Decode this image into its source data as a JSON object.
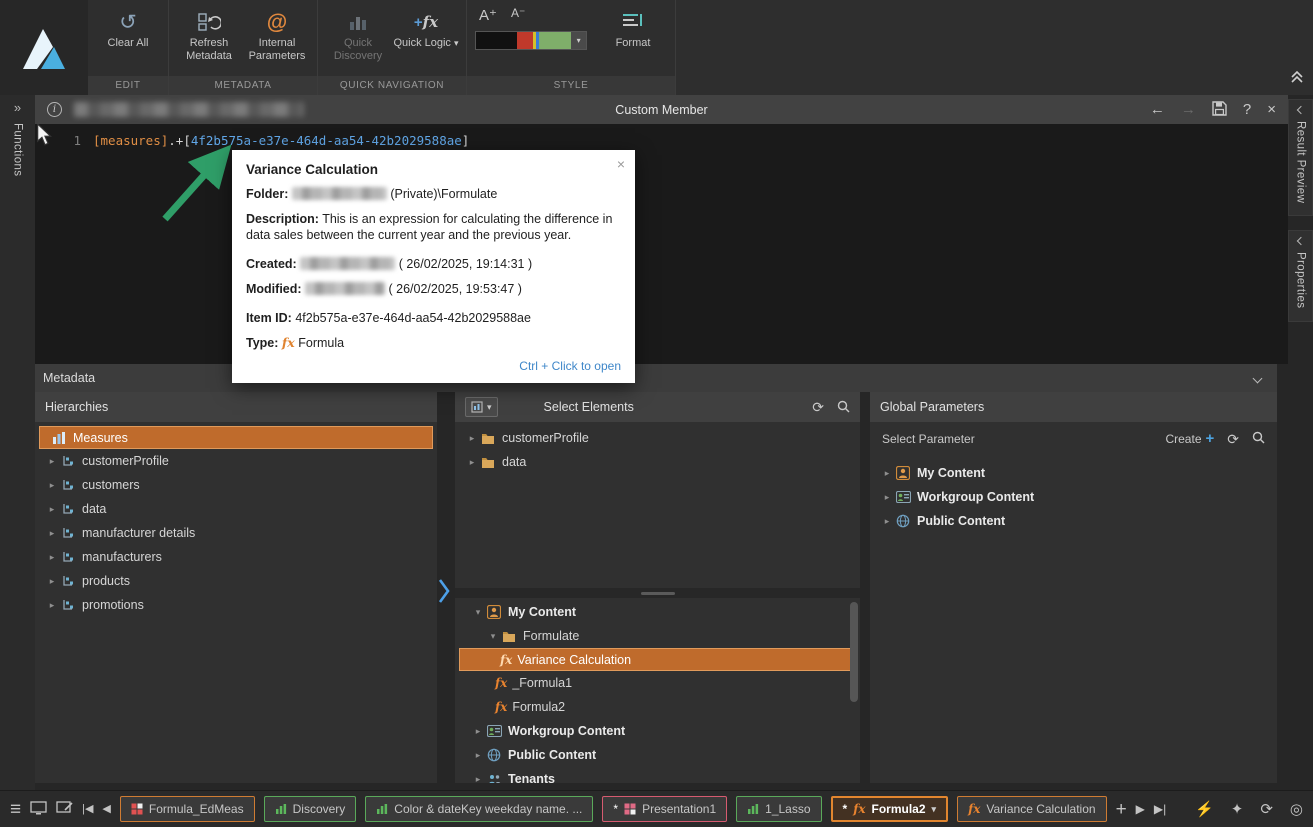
{
  "ribbon": {
    "groups": [
      {
        "label": "EDIT"
      },
      {
        "label": "METADATA"
      },
      {
        "label": "QUICK NAVIGATION"
      },
      {
        "label": "STYLE"
      }
    ],
    "buttons": {
      "clear_all": "Clear All",
      "refresh_metadata": "Refresh Metadata",
      "internal_parameters": "Internal Parameters",
      "quick_discovery": "Quick Discovery",
      "quick_logic": "Quick Logic",
      "format": "Format"
    }
  },
  "editor": {
    "title": "Custom Member",
    "line_number": "1",
    "code": {
      "measure": "[measures]",
      "operator": ".+",
      "bracket_open": "[",
      "guid": "4f2b575a-e37e-464d-aa54-42b2029588ae",
      "bracket_close": "]"
    }
  },
  "tooltip": {
    "title": "Variance Calculation",
    "folder_label": "Folder:",
    "folder_value": "(Private)\\Formulate",
    "description_label": "Description:",
    "description": "This is an expression for calculating the difference in data sales between the current year and the previous year.",
    "created_label": "Created:",
    "created_value": "( 26/02/2025, 19:14:31 )",
    "modified_label": "Modified:",
    "modified_value": "( 26/02/2025, 19:53:47 )",
    "item_id_label": "Item ID:",
    "item_id": "4f2b575a-e37e-464d-aa54-42b2029588ae",
    "type_label": "Type:",
    "type_value": "Formula",
    "open_hint": "Ctrl + Click to open"
  },
  "side_tabs": {
    "left": "Functions",
    "right": [
      {
        "label": "Result Preview"
      },
      {
        "label": "Properties"
      }
    ]
  },
  "metadata_section": {
    "title": "Metadata"
  },
  "hierarchies": {
    "title": "Hierarchies",
    "items": [
      {
        "label": "Measures",
        "selected": true
      },
      {
        "label": "customerProfile"
      },
      {
        "label": "customers"
      },
      {
        "label": "data"
      },
      {
        "label": "manufacturer details"
      },
      {
        "label": "manufacturers"
      },
      {
        "label": "products"
      },
      {
        "label": "promotions"
      }
    ]
  },
  "select_elements": {
    "title": "Select Elements",
    "folders": [
      {
        "label": "customerProfile"
      },
      {
        "label": "data"
      }
    ],
    "content_tree": [
      {
        "label": "My Content"
      },
      {
        "label": "Formulate"
      },
      {
        "label": "Variance Calculation",
        "selected": true
      },
      {
        "label": "_Formula1"
      },
      {
        "label": "Formula2"
      },
      {
        "label": "Workgroup Content"
      },
      {
        "label": "Public Content"
      },
      {
        "label": "Tenants"
      }
    ]
  },
  "global_parameters": {
    "title": "Global Parameters",
    "select_label": "Select Parameter",
    "create_label": "Create",
    "items": [
      {
        "label": "My Content"
      },
      {
        "label": "Workgroup Content"
      },
      {
        "label": "Public Content"
      }
    ]
  },
  "taskbar": {
    "tabs": [
      {
        "label": "Formula_EdMeas",
        "color": "orange"
      },
      {
        "label": "Discovery",
        "color": "green"
      },
      {
        "label": "Color & dateKey weekday name. ...",
        "color": "green"
      },
      {
        "label": "Presentation1",
        "color": "pink",
        "prefix": "*"
      },
      {
        "label": "1_Lasso",
        "color": "green"
      },
      {
        "label": "Formula2",
        "color": "orange",
        "prefix": "*",
        "active": true
      },
      {
        "label": "Variance Calculation",
        "color": "orange"
      }
    ]
  },
  "icons": {
    "clear_all": "↺",
    "at": "@",
    "font_increase": "A⁺",
    "font_decrease": "A⁻",
    "dropdown_caret": "▾",
    "info": "i",
    "back": "←",
    "forward": "→",
    "help": "?",
    "close": "×",
    "expand_left": "»",
    "refresh": "⟳",
    "plus": "+",
    "expander_collapsed": "▸",
    "expander_expanded": "▾",
    "hamburger": "≡",
    "first_tab": "|◀",
    "prev_tab": "◀",
    "add": "+",
    "play": "▶",
    "play_last": "▶|",
    "bolt": "⚡",
    "sparkle": "✦",
    "target": "◎",
    "fx": "fx"
  },
  "colors": {
    "accent_orange": "#bf6b2c",
    "selection_border": "#e09a5b",
    "tab_green": "#5aa95a",
    "tab_orange": "#cf7c33",
    "tab_pink": "#d65b70",
    "link": "#3f87c9",
    "guid_blue": "#61a7e8",
    "measure_orange": "#e08e45",
    "arrow_green": "#2f9e68"
  }
}
